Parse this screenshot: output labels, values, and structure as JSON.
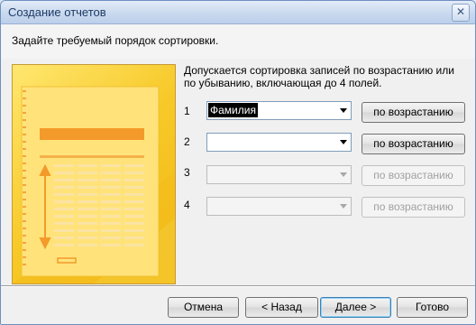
{
  "window": {
    "title": "Создание отчетов",
    "close_glyph": "✕"
  },
  "prompt": "Задайте требуемый порядок сортировки.",
  "instructions": "Допускается сортировка записей по возрастанию или по убыванию, включающая до 4 полей.",
  "sort_rows": [
    {
      "number": "1",
      "field": "Фамилия",
      "order": "по возрастанию",
      "enabled": true
    },
    {
      "number": "2",
      "field": "",
      "order": "по возрастанию",
      "enabled": true
    },
    {
      "number": "3",
      "field": "",
      "order": "по возрастанию",
      "enabled": false
    },
    {
      "number": "4",
      "field": "",
      "order": "по возрастанию",
      "enabled": false
    }
  ],
  "footer": {
    "cancel": "Отмена",
    "back": "< Назад",
    "next": "Далее >",
    "finish": "Готово"
  },
  "colors": {
    "accent": "#3c7fb1",
    "illustration": "#f7c928"
  }
}
